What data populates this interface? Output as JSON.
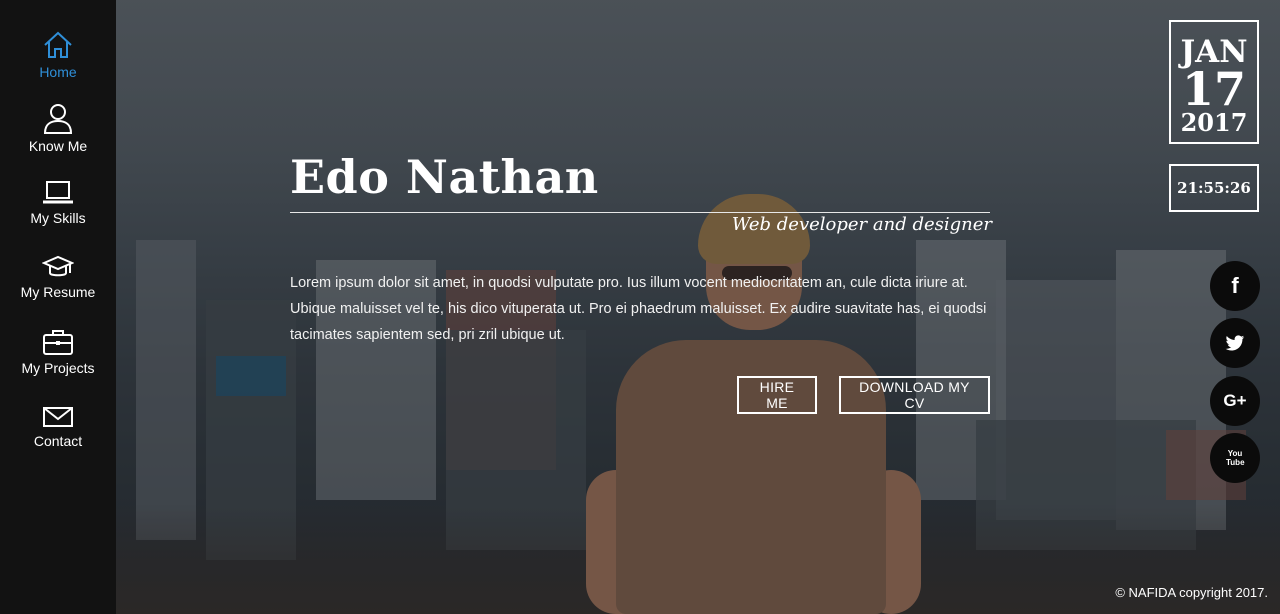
{
  "sidebar": {
    "items": [
      {
        "label": "Home",
        "icon": "home-icon",
        "active": true
      },
      {
        "label": "Know Me",
        "icon": "user-icon"
      },
      {
        "label": "My Skills",
        "icon": "laptop-icon"
      },
      {
        "label": "My Resume",
        "icon": "graduation-cap-icon"
      },
      {
        "label": "My Projects",
        "icon": "briefcase-icon"
      },
      {
        "label": "Contact",
        "icon": "envelope-icon"
      }
    ],
    "active_color": "#2f8fd8"
  },
  "hero": {
    "name": "Edo Nathan",
    "subtitle": "Web developer and designer",
    "intro": "Lorem ipsum dolor sit amet, in quodsi vulputate pro. Ius illum vocent mediocritatem an, cule dicta iriure at. Ubique maluisset vel te, his dico vituperata ut. Pro ei phaedrum maluisset. Ex audire suavitate has, ei quodsi tacimates sapientem sed, pri zril ubique ut.",
    "hire_label": "HIRE ME",
    "cv_label": "DOWNLOAD MY CV"
  },
  "date": {
    "month": "JAN",
    "day": "17",
    "year": "2017"
  },
  "clock": {
    "time": "21:55:26"
  },
  "social": [
    {
      "icon": "facebook-icon",
      "glyph": "f"
    },
    {
      "icon": "twitter-icon",
      "glyph": "🐦"
    },
    {
      "icon": "google-plus-icon",
      "glyph": "G+"
    },
    {
      "icon": "youtube-icon",
      "glyph": "You Tube"
    }
  ],
  "footer": {
    "copyright": "© NAFIDA copyright 2017."
  }
}
